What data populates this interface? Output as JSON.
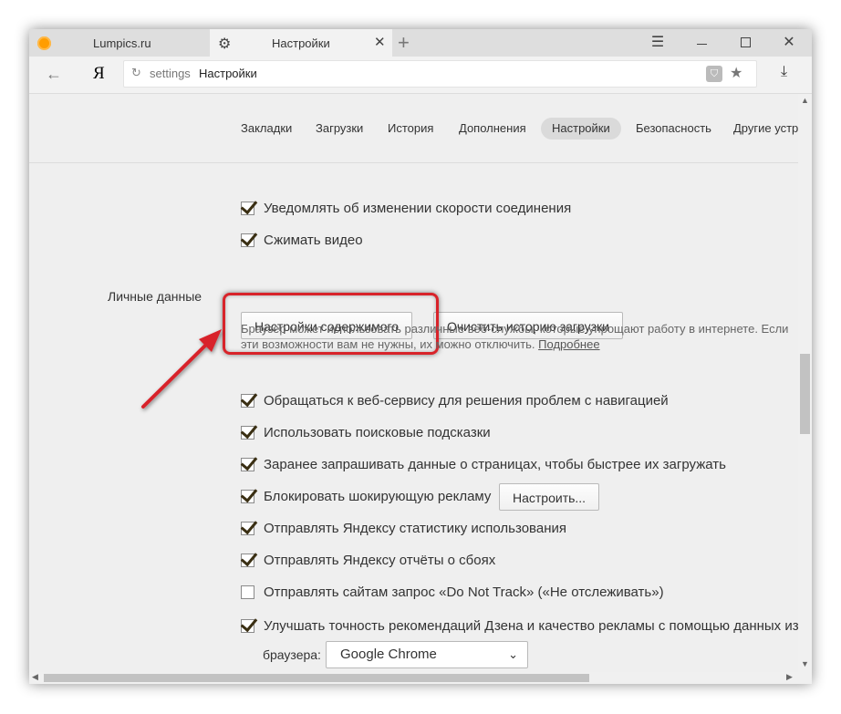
{
  "tabs": [
    {
      "title": "Lumpics.ru",
      "icon": "orange-circle-icon"
    },
    {
      "title": "Настройки",
      "icon": "gear-icon"
    }
  ],
  "address": {
    "protocol": "settings",
    "page": "Настройки"
  },
  "logo": "Я",
  "nav": [
    "Закладки",
    "Загрузки",
    "История",
    "Дополнения",
    "Настройки",
    "Безопасность",
    "Другие устрой"
  ],
  "active_nav": "Настройки",
  "top_checkboxes": [
    {
      "label": "Уведомлять об изменении скорости соединения",
      "checked": true
    },
    {
      "label": "Сжимать видео",
      "checked": true
    }
  ],
  "personal": {
    "label": "Личные данные",
    "content_settings_button": "Настройки содержимого",
    "clear_history_button": "Очистить историю загрузки",
    "description": "Браузер может использовать различные веб-службы, которые упрощают работу в интернете. Если эти возможности вам не нужны, их можно отключить.",
    "more_link": "Подробнее"
  },
  "checkboxes": [
    {
      "label": "Обращаться к веб-сервису для решения проблем с навигацией",
      "checked": true
    },
    {
      "label": "Использовать поисковые подсказки",
      "checked": true
    },
    {
      "label": "Заранее запрашивать данные о страницах, чтобы быстрее их загружать",
      "checked": true
    },
    {
      "label": "Блокировать шокирующую рекламу",
      "checked": true
    },
    {
      "label": "Отправлять Яндексу статистику использования",
      "checked": true
    },
    {
      "label": "Отправлять Яндексу отчёты о сбоях",
      "checked": true
    },
    {
      "label": "Отправлять сайтам запрос «Do Not Track» («Не отслеживать»)",
      "checked": false
    },
    {
      "label": "Улучшать точность рекомендаций Дзена и качество рекламы с помощью данных из",
      "checked": true
    }
  ],
  "configure_button": "Настроить...",
  "browser_label": "браузера:",
  "browser_select": "Google Chrome",
  "colors": {
    "highlight": "#d8232a",
    "checkmark": "#3a2f13",
    "accent_orange": "#ff9d00"
  }
}
